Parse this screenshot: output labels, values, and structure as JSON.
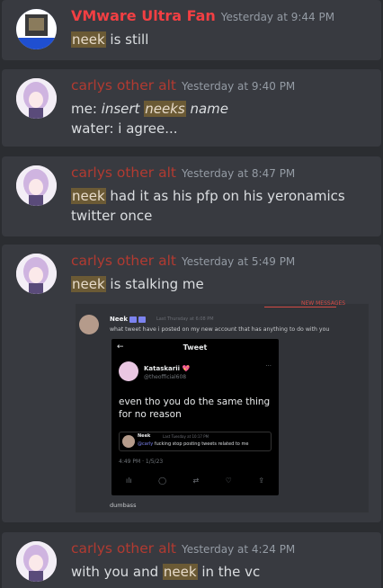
{
  "messages": [
    {
      "author": "VMware Ultra Fan",
      "timestamp": "Yesterday at 9:44 PM",
      "content_hl": "neek",
      "content_rest": " is still"
    },
    {
      "author": "carlys other alt",
      "timestamp": "Yesterday at 9:40 PM",
      "line1_prefix": "me: ",
      "line1_em_a": "insert ",
      "line1_em_hl": "neeks",
      "line1_em_b": " name",
      "line2": "water: i agree..."
    },
    {
      "author": "carlys other alt",
      "timestamp": "Yesterday at 8:47 PM",
      "content_hl": "neek",
      "content_rest": " had it as his pfp on his yeronamics twitter once"
    },
    {
      "author": "carlys other alt",
      "timestamp": "Yesterday at 5:49 PM",
      "content_hl": "neek",
      "content_rest": " is stalking me",
      "attachment": {
        "new_messages": "NEW MESSAGES",
        "author": "Neek",
        "timestamp": "Last Thursday at 6:08 PM",
        "text": "what tweet have i posted on my new account that has anything to do with you",
        "footer": "dumbass",
        "tweet": {
          "back": "←",
          "title": "Tweet",
          "user": "Kataskarii",
          "heart": "💖",
          "handle": "@theofficial608",
          "more": "···",
          "text": "even tho you do the same thing for no reason",
          "quote_author": "Neek",
          "quote_ts": "Last Tuesday at 10:17 PM",
          "quote_mention": "@carly",
          "quote_text": " fucking stop posting tweets related to me",
          "meta": "4:49 PM · 1/5/23",
          "actions": [
            "ılı",
            "◯",
            "⇄",
            "♡",
            "⇪"
          ]
        }
      }
    },
    {
      "author": "carlys other alt",
      "timestamp": "Yesterday at 4:24 PM",
      "content_a": "with you and ",
      "content_hl": "neek",
      "content_b": " in the vc"
    }
  ]
}
